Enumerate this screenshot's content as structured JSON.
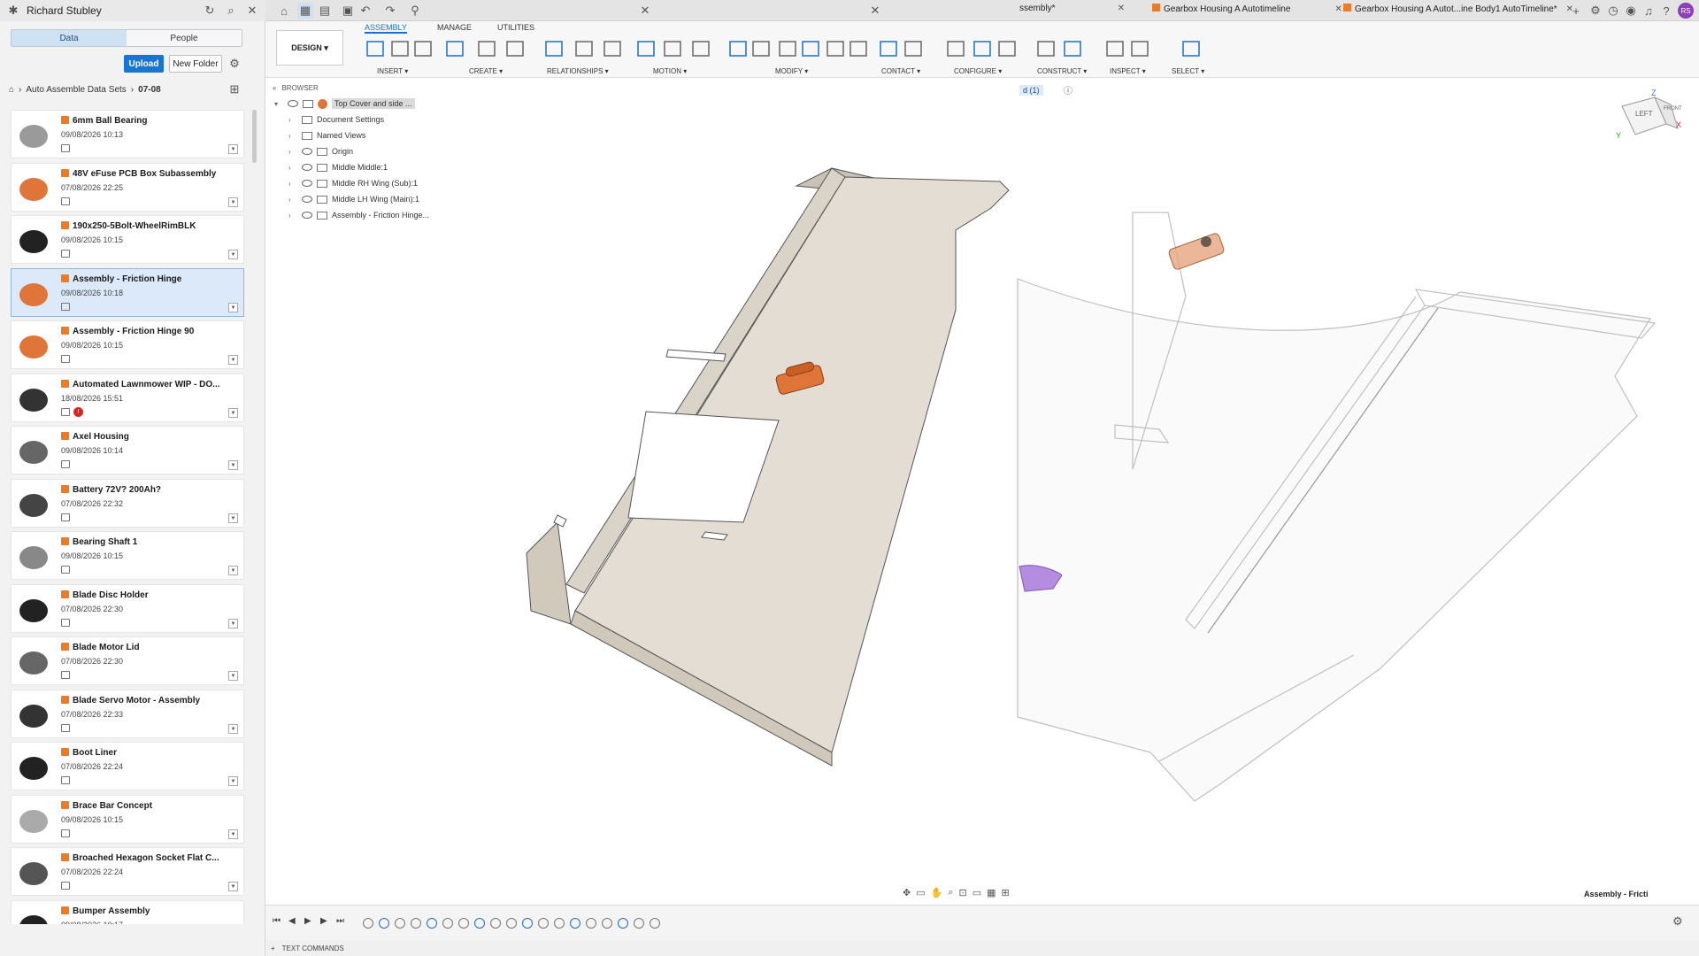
{
  "user": {
    "name": "Richard Stubley"
  },
  "panel": {
    "tab_data": "Data",
    "tab_people": "People",
    "upload": "Upload",
    "new_folder": "New Folder"
  },
  "breadcrumbs": {
    "parent": "Auto Assemble Data Sets",
    "current": "07-08"
  },
  "files": [
    {
      "name": "6mm Ball Bearing",
      "date": "09/08/2026 10:13"
    },
    {
      "name": "48V eFuse PCB Box Subassembly",
      "date": "07/08/2026 22:25"
    },
    {
      "name": "190x250-5Bolt-WheelRimBLK",
      "date": "09/08/2026 10:15"
    },
    {
      "name": "Assembly - Friction Hinge",
      "date": "09/08/2026 10:18"
    },
    {
      "name": "Assembly - Friction Hinge 90",
      "date": "09/08/2026 10:15"
    },
    {
      "name": "Automated Lawnmower WIP - DO...",
      "date": "18/08/2026 15:51"
    },
    {
      "name": "Axel Housing",
      "date": "09/08/2026 10:14"
    },
    {
      "name": "Battery 72V? 200Ah?",
      "date": "07/08/2026 22:32"
    },
    {
      "name": "Bearing Shaft 1",
      "date": "09/08/2026 10:15"
    },
    {
      "name": "Blade Disc Holder",
      "date": "07/08/2026 22:30"
    },
    {
      "name": "Blade Motor Lid",
      "date": "07/08/2026 22:30"
    },
    {
      "name": "Blade Servo Motor - Assembly",
      "date": "07/08/2026 22:33"
    },
    {
      "name": "Boot Liner",
      "date": "07/08/2026 22:24"
    },
    {
      "name": "Brace Bar Concept",
      "date": "09/08/2026 10:15"
    },
    {
      "name": "Broached Hexagon Socket Flat C...",
      "date": "07/08/2026 22:24"
    },
    {
      "name": "Bumper Assembly",
      "date": "09/08/2026 10:17"
    }
  ],
  "doc_tabs": [
    "ssembly*",
    "Gearbox Housing A Autotimeline",
    "Gearbox Housing A Autot...ine Body1 AutoTimeline*"
  ],
  "ribbon_tabs": [
    "ASSEMBLY",
    "MANAGE",
    "UTILITIES"
  ],
  "workspace": "DESIGN",
  "groups": [
    "INSERT",
    "CREATE",
    "RELATIONSHIPS",
    "MOTION",
    "MODIFY",
    "CONTACT",
    "CONFIGURE",
    "CONSTRUCT",
    "INSPECT",
    "SELECT"
  ],
  "browser": {
    "title": "BROWSER",
    "root": "Top Cover and side ...",
    "rows": [
      "Document Settings",
      "Named Views",
      "Origin",
      "Middle Middle:1",
      "Middle RH Wing (Sub):1",
      "Middle LH Wing (Main):1",
      "Assembly - Friction Hinge..."
    ]
  },
  "viewcube": {
    "left": "LEFT",
    "front": "FRONT",
    "z": "Z",
    "x": "X",
    "y": "Y"
  },
  "selection_chip": "d (1)",
  "corner_label": "Assembly - Fricti",
  "text_commands": "TEXT COMMANDS",
  "user_initials": "RS",
  "colors": {
    "accent": "#1876d2",
    "hinge": "#e0753a",
    "part": "#e3ddd3",
    "selection": "#dbe9f8"
  }
}
